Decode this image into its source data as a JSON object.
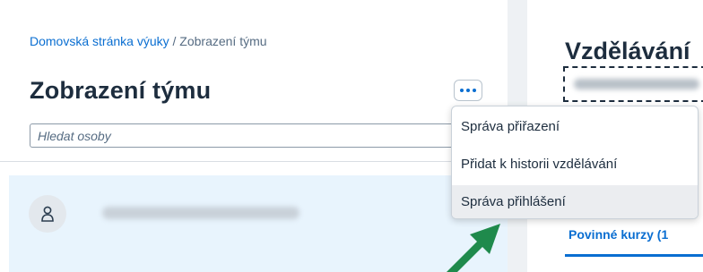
{
  "breadcrumb": {
    "home_link": "Domovská stránka výuky",
    "separator": " / ",
    "current": "Zobrazení týmu"
  },
  "page": {
    "title": "Zobrazení týmu"
  },
  "more_button": {
    "icon": "more-horizontal-icon"
  },
  "search": {
    "placeholder": "Hledat osoby"
  },
  "person": {
    "avatar_icon": "person-icon"
  },
  "right_panel": {
    "title": "Vzdělávání",
    "tab_label": "Povinné kurzy (1"
  },
  "menu": {
    "items": [
      {
        "label": "Správa přiřazení"
      },
      {
        "label": "Přidat k historii vzdělávání"
      },
      {
        "label": "Správa přihlášení"
      }
    ]
  },
  "annotation": {
    "arrow_color": "#1f8a4c",
    "accent_color": "#0a6ed1"
  }
}
